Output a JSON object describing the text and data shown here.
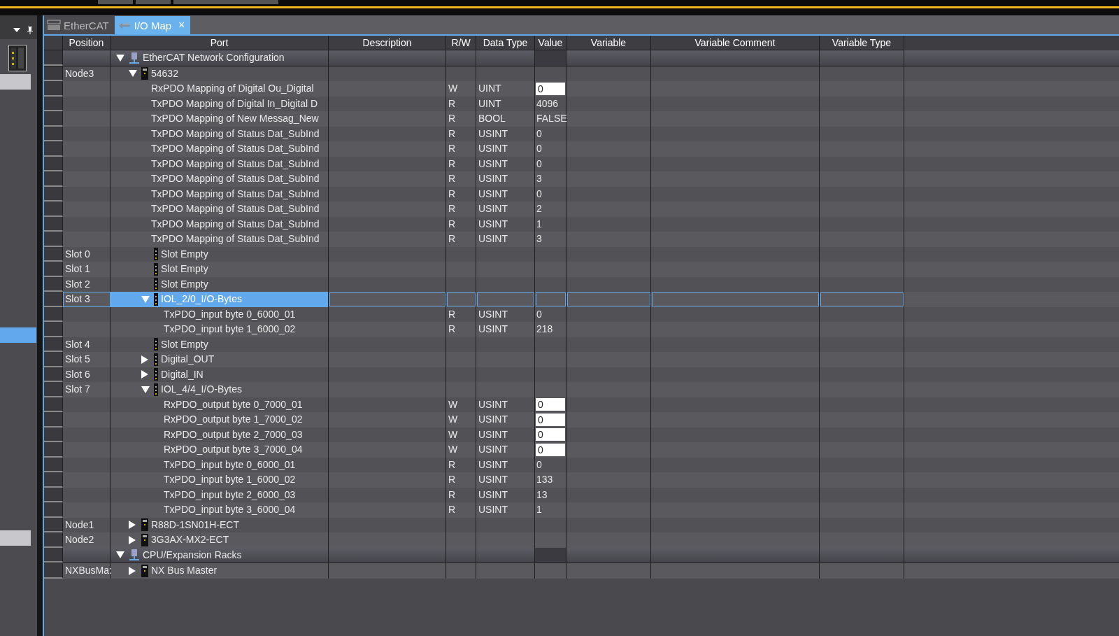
{
  "tabs": [
    {
      "label": "EtherCAT",
      "kind": "ecat",
      "selected": false
    },
    {
      "label": "I/O Map",
      "kind": "io-map",
      "selected": true,
      "close": "×"
    }
  ],
  "columns": [
    "Position",
    "Port",
    "Description",
    "R/W",
    "Data Type",
    "Value",
    "Variable",
    "Variable Comment",
    "Variable Type"
  ],
  "rows": [
    {
      "kind": "network",
      "port": "EtherCAT Network Configuration",
      "expanded": true,
      "selected": false,
      "children": [
        {
          "kind": "device",
          "position": "Node3",
          "port": "54632",
          "expanded": true,
          "selected": false,
          "children": [
            {
              "kind": "pdo",
              "port": "RxPDO Mapping of Digital Ou_Digital",
              "rw": "W",
              "data_type": "UINT",
              "value": "0",
              "editable": true,
              "selected": false
            },
            {
              "kind": "pdo",
              "port": "TxPDO Mapping of Digital In_Digital D",
              "rw": "R",
              "data_type": "UINT",
              "value": "4096",
              "editable": false,
              "selected": false
            },
            {
              "kind": "pdo",
              "port": "TxPDO Mapping of New Messag_New",
              "rw": "R",
              "data_type": "BOOL",
              "value": "FALSE",
              "editable": false,
              "selected": false
            },
            {
              "kind": "pdo",
              "port": "TxPDO Mapping of Status Dat_SubInd",
              "rw": "R",
              "data_type": "USINT",
              "value": "0",
              "editable": false,
              "selected": false
            },
            {
              "kind": "pdo",
              "port": "TxPDO Mapping of Status Dat_SubInd",
              "rw": "R",
              "data_type": "USINT",
              "value": "0",
              "editable": false,
              "selected": false
            },
            {
              "kind": "pdo",
              "port": "TxPDO Mapping of Status Dat_SubInd",
              "rw": "R",
              "data_type": "USINT",
              "value": "0",
              "editable": false,
              "selected": false
            },
            {
              "kind": "pdo",
              "port": "TxPDO Mapping of Status Dat_SubInd",
              "rw": "R",
              "data_type": "USINT",
              "value": "3",
              "editable": false,
              "selected": false
            },
            {
              "kind": "pdo",
              "port": "TxPDO Mapping of Status Dat_SubInd",
              "rw": "R",
              "data_type": "USINT",
              "value": "0",
              "editable": false,
              "selected": false
            },
            {
              "kind": "pdo",
              "port": "TxPDO Mapping of Status Dat_SubInd",
              "rw": "R",
              "data_type": "USINT",
              "value": "2",
              "editable": false,
              "selected": false
            },
            {
              "kind": "pdo",
              "port": "TxPDO Mapping of Status Dat_SubInd",
              "rw": "R",
              "data_type": "USINT",
              "value": "1",
              "editable": false,
              "selected": false
            },
            {
              "kind": "pdo",
              "port": "TxPDO Mapping of Status Dat_SubInd",
              "rw": "R",
              "data_type": "USINT",
              "value": "3",
              "editable": false,
              "selected": false
            },
            {
              "kind": "slot",
              "position": "Slot 0",
              "port": "Slot Empty",
              "selected": false
            },
            {
              "kind": "slot",
              "position": "Slot 1",
              "port": "Slot Empty",
              "selected": false
            },
            {
              "kind": "slot",
              "position": "Slot 2",
              "port": "Slot Empty",
              "selected": false
            },
            {
              "kind": "slot",
              "position": "Slot 3",
              "port": "IOL_2/0_I/O-Bytes",
              "expanded": true,
              "selected": true,
              "children": [
                {
                  "kind": "pdo",
                  "port": "TxPDO_input byte 0_6000_01",
                  "rw": "R",
                  "data_type": "USINT",
                  "value": "0",
                  "editable": false,
                  "selected": false
                },
                {
                  "kind": "pdo",
                  "port": "TxPDO_input byte 1_6000_02",
                  "rw": "R",
                  "data_type": "USINT",
                  "value": "218",
                  "editable": false,
                  "selected": false
                }
              ]
            },
            {
              "kind": "slot",
              "position": "Slot 4",
              "port": "Slot Empty",
              "selected": false
            },
            {
              "kind": "slot",
              "position": "Slot 5",
              "port": "Digital_OUT",
              "expanded": false,
              "selected": false
            },
            {
              "kind": "slot",
              "position": "Slot 6",
              "port": "Digital_IN",
              "expanded": false,
              "selected": false
            },
            {
              "kind": "slot",
              "position": "Slot 7",
              "port": "IOL_4/4_I/O-Bytes",
              "expanded": true,
              "selected": false,
              "children": [
                {
                  "kind": "pdo",
                  "port": "RxPDO_output byte 0_7000_01",
                  "rw": "W",
                  "data_type": "USINT",
                  "value": "0",
                  "editable": true,
                  "selected": false
                },
                {
                  "kind": "pdo",
                  "port": "RxPDO_output byte 1_7000_02",
                  "rw": "W",
                  "data_type": "USINT",
                  "value": "0",
                  "editable": true,
                  "selected": false
                },
                {
                  "kind": "pdo",
                  "port": "RxPDO_output byte 2_7000_03",
                  "rw": "W",
                  "data_type": "USINT",
                  "value": "0",
                  "editable": true,
                  "selected": false
                },
                {
                  "kind": "pdo",
                  "port": "RxPDO_output byte 3_7000_04",
                  "rw": "W",
                  "data_type": "USINT",
                  "value": "0",
                  "editable": true,
                  "selected": false
                },
                {
                  "kind": "pdo",
                  "port": "TxPDO_input byte 0_6000_01",
                  "rw": "R",
                  "data_type": "USINT",
                  "value": "0",
                  "editable": false,
                  "selected": false
                },
                {
                  "kind": "pdo",
                  "port": "TxPDO_input byte 1_6000_02",
                  "rw": "R",
                  "data_type": "USINT",
                  "value": "133",
                  "editable": false,
                  "selected": false
                },
                {
                  "kind": "pdo",
                  "port": "TxPDO_input byte 2_6000_03",
                  "rw": "R",
                  "data_type": "USINT",
                  "value": "13",
                  "editable": false,
                  "selected": false
                },
                {
                  "kind": "pdo",
                  "port": "TxPDO_input byte 3_6000_04",
                  "rw": "R",
                  "data_type": "USINT",
                  "value": "1",
                  "editable": false,
                  "selected": false
                }
              ]
            }
          ]
        },
        {
          "kind": "device",
          "position": "Node1",
          "port": "R88D-1SN01H-ECT",
          "expanded": false,
          "selected": false
        },
        {
          "kind": "device",
          "position": "Node2",
          "port": "3G3AX-MX2-ECT",
          "expanded": false,
          "selected": false
        }
      ]
    },
    {
      "kind": "network",
      "port": "CPU/Expansion Racks",
      "expanded": true,
      "selected": false,
      "children": [
        {
          "kind": "device",
          "position": "NXBusMa:",
          "port": "NX Bus Master",
          "expanded": false,
          "selected": false
        }
      ]
    }
  ]
}
